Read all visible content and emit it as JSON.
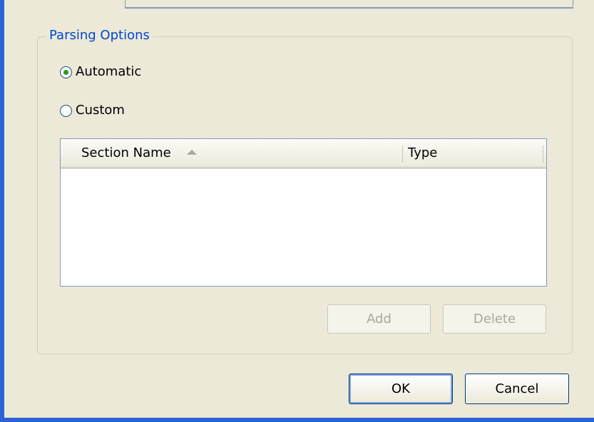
{
  "group": {
    "title": "Parsing Options"
  },
  "radios": [
    {
      "label": "Automatic",
      "selected": true
    },
    {
      "label": "Custom",
      "selected": false
    }
  ],
  "list": {
    "columns": [
      {
        "label": "Section Name",
        "sort": "ascending"
      },
      {
        "label": "Type"
      }
    ],
    "rows": []
  },
  "list_buttons": {
    "add_label": "Add",
    "delete_label": "Delete",
    "add_enabled": false,
    "delete_enabled": false
  },
  "dialog_buttons": {
    "ok_label": "OK",
    "cancel_label": "Cancel"
  },
  "colors": {
    "window_frame": "#2b63d4",
    "dialog_background": "#ece9d8",
    "group_title": "#0046d5",
    "radio_dot": "#21a121",
    "disabled_text": "#aca899"
  }
}
